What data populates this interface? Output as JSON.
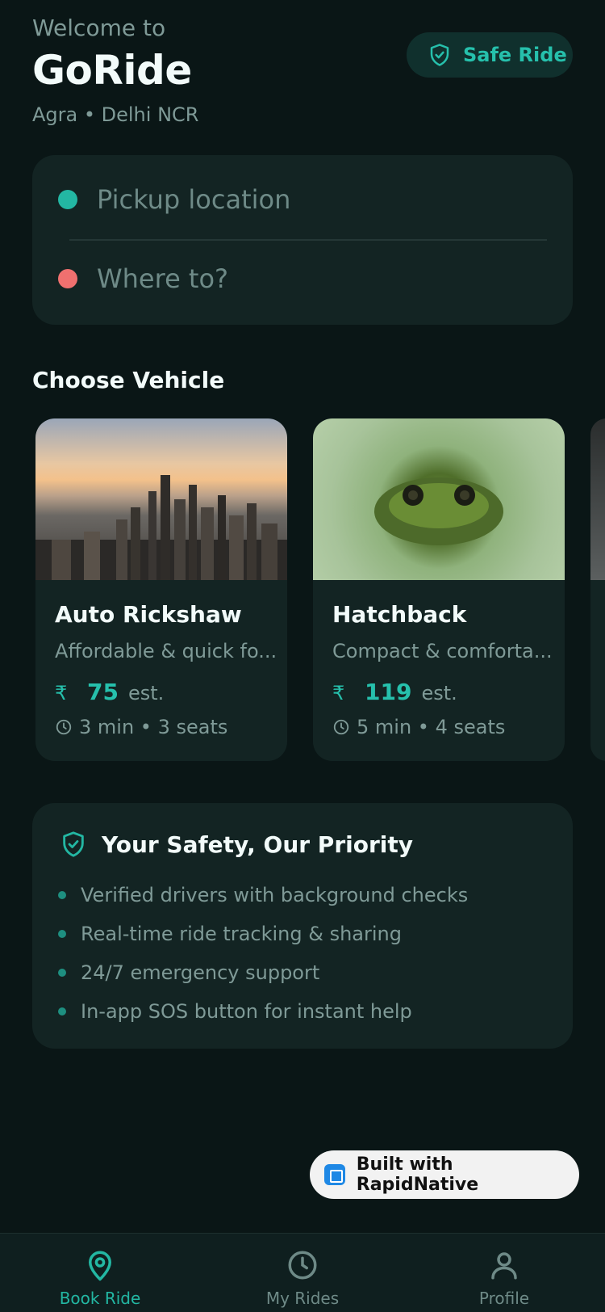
{
  "header": {
    "welcome": "Welcome to",
    "title": "GoRide",
    "location": "Agra • Delhi NCR",
    "safe_ride_label": "Safe Ride"
  },
  "search": {
    "pickup_placeholder": "Pickup location",
    "dropoff_placeholder": "Where to?"
  },
  "vehicles": {
    "section_title": "Choose Vehicle",
    "items": [
      {
        "name": "Auto Rickshaw",
        "description": "Affordable & quick fo...",
        "currency": "₹",
        "price": "75",
        "price_suffix": "est.",
        "meta": "3 min • 3 seats"
      },
      {
        "name": "Hatchback",
        "description": "Compact & comforta...",
        "currency": "₹",
        "price": "119",
        "price_suffix": "est.",
        "meta": "5 min • 4 seats"
      }
    ]
  },
  "safety": {
    "title": "Your Safety, Our Priority",
    "items": [
      "Verified drivers with background checks",
      "Real-time ride tracking & sharing",
      "24/7 emergency support",
      "In-app SOS button for instant help"
    ]
  },
  "badge": {
    "label": "Built with RapidNative"
  },
  "nav": {
    "items": [
      {
        "label": "Book Ride",
        "icon": "map-pin-icon"
      },
      {
        "label": "My Rides",
        "icon": "clock-icon"
      },
      {
        "label": "Profile",
        "icon": "user-icon"
      }
    ],
    "active": "Book Ride"
  },
  "colors": {
    "accent": "#23b7a3",
    "background": "#0a1616",
    "card": "#132423",
    "pickup_dot": "#23b7a3",
    "dropoff_dot": "#f0706f"
  }
}
